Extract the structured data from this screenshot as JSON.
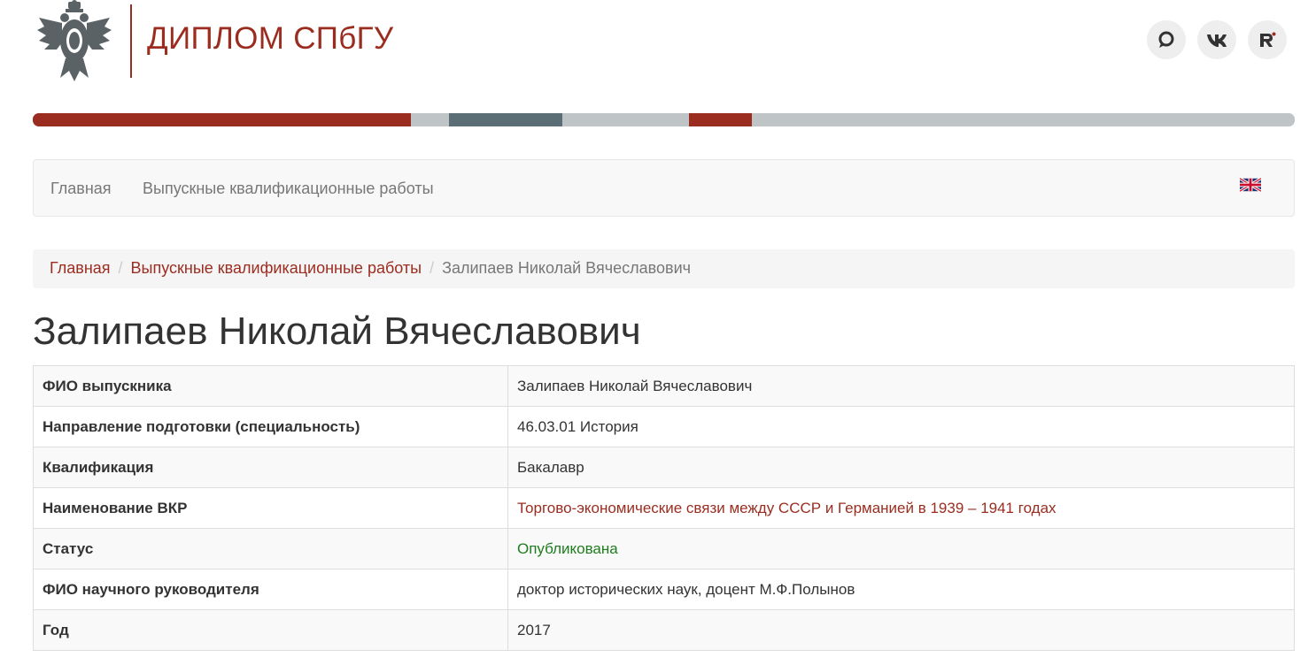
{
  "header": {
    "site_title": "ДИПЛОМ СПбГУ",
    "social": [
      {
        "icon": "ok-icon",
        "name": "odnoklassniki-button"
      },
      {
        "icon": "vk-icon",
        "name": "vk-button"
      },
      {
        "icon": "r-icon",
        "name": "rutube-button"
      }
    ]
  },
  "colors": {
    "brand": "#9b2d20",
    "stripe_gray": "#bfc4c7",
    "stripe_dark": "#5c6e75",
    "status_green": "#1e7d1e"
  },
  "navbar": {
    "home": "Главная",
    "theses": "Выпускные квалификационные работы",
    "language_icon": "uk-flag-icon"
  },
  "breadcrumb": {
    "items": [
      "Главная",
      "Выпускные квалификационные работы"
    ],
    "current": "Залипаев Николай Вячеславович"
  },
  "page": {
    "title": "Залипаев Николай Вячеславович"
  },
  "details": [
    {
      "label": "ФИО выпускника",
      "value": "Залипаев Николай Вячеславович"
    },
    {
      "label": "Направление подготовки (специальность)",
      "value": "46.03.01 История"
    },
    {
      "label": "Квалификация",
      "value": "Бакалавр"
    },
    {
      "label": "Наименование ВКР",
      "value": "Торгово-экономические связи между СССР и Германией в 1939 – 1941 годах"
    },
    {
      "label": "Статус",
      "value": "Опубликована"
    },
    {
      "label": "ФИО научного руководителя",
      "value": "доктор исторических наук, доцент М.Ф.Полынов"
    },
    {
      "label": "Год",
      "value": "2017"
    }
  ]
}
